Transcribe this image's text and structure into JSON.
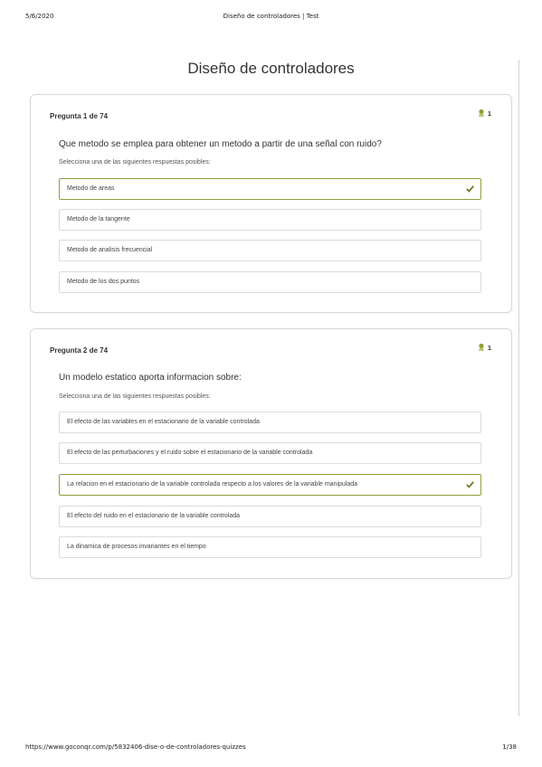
{
  "print_header": {
    "date": "5/6/2020",
    "title": "Diseño de controladores | Test"
  },
  "print_footer": {
    "url": "https://www.goconqr.com/p/5832406-dise-o-de-controladores-quizzes",
    "page": "1/38"
  },
  "page_title": "Diseño de controladores",
  "colors": {
    "correct_border": "#8aa13a",
    "check": "#6a7f2a",
    "points_icon": "#8aa13a"
  },
  "questions": [
    {
      "count": "Pregunta 1 de 74",
      "points": "1",
      "text": "Que metodo se emplea para obtener un metodo a partir de una señal con ruido?",
      "instruction": "Selecciona una de las siguientes respuestas posibles:",
      "options": [
        {
          "label": "Metodo de areas",
          "correct": true
        },
        {
          "label": "Metodo de la tangente",
          "correct": false
        },
        {
          "label": "Metodo de analisis frecuencial",
          "correct": false
        },
        {
          "label": "Metodo de los dos puntos",
          "correct": false
        }
      ]
    },
    {
      "count": "Pregunta 2 de 74",
      "points": "1",
      "text": "Un modelo estatico aporta informacion sobre:",
      "instruction": "Selecciona una de las siguientes respuestas posibles:",
      "options": [
        {
          "label": "El efecto de las variables en el estacionario de la variable controlada",
          "correct": false
        },
        {
          "label": "El efecto de las perturbaciones y el ruido sobre el estacionario de la variable controlada",
          "correct": false
        },
        {
          "label": "La relacion en el estacionario de la variable controlada respecto a los valores de la variable manipulada",
          "correct": true
        },
        {
          "label": "El efecto del ruido en el estacionario de la variable controlada",
          "correct": false
        },
        {
          "label": "La dinamica de procesos invariantes en el tiempo",
          "correct": false
        }
      ]
    }
  ]
}
